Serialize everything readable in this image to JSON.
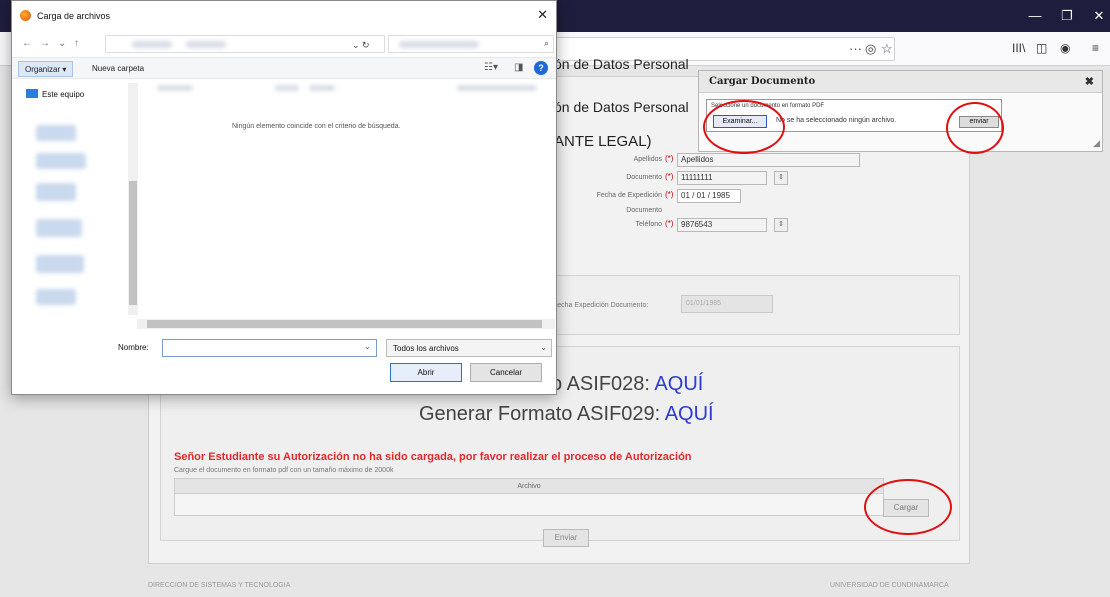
{
  "browser": {
    "window_controls": [
      "—",
      "❐",
      "✕"
    ],
    "url_actions": [
      "···",
      "◎",
      "☆"
    ],
    "toolbar_icons": [
      "III\\",
      "◫",
      "◉",
      "≡"
    ]
  },
  "page": {
    "heading_1": "ón de Datos Personal",
    "heading_2": "ón de Datos Personal",
    "heading_3": "ANTE LEGAL)",
    "form": {
      "apellidos_label": "Apellidos",
      "apellidos_value": "Apellidos",
      "documento_label": "Documento",
      "documento_value": "11111111",
      "fecha_label": "Fecha de Expedición",
      "fecha_label_2": "Documento",
      "fecha_value": "01 / 01 / 1985",
      "telefono_label": "Teléfono",
      "telefono_value": "9876543",
      "required_mark": "(*)"
    },
    "fecha_panel_label": "Fecha Expedición Documento:",
    "fecha_panel_value": "01/01/1985",
    "formats": {
      "line_1_prefix": "o ASIF028: ",
      "line_2_prefix": "Generar Formato ASIF029: ",
      "link_text": "AQUÍ"
    },
    "warning": "Señor Estudiante su Autorización no ha sido cargada, por favor realizar el proceso de Autorización",
    "upload_note": "Cargue el documento en formato pdf con un tamaño máximo de 2000k",
    "archivo_header": "Archivo",
    "cargar_button": "Cargar",
    "enviar_button": "Enviar",
    "footer_left": "DIRECCION DE SISTEMAS Y TECNOLOGIA",
    "footer_right": "UNIVERSIDAD DE CUNDINAMARCA"
  },
  "cargar_dialog": {
    "title": "Cargar Documento",
    "close": "✖",
    "instruction": "Seleccione un documento en formato PDF",
    "browse_button": "Examinar...",
    "no_file_text": "No se ha seleccionado ningún archivo.",
    "send_button": "enviar"
  },
  "file_dialog": {
    "title": "Carga de archivos",
    "close": "✕",
    "nav_back": "←",
    "nav_forward": "→",
    "nav_down": "⌄",
    "nav_up": "↑",
    "refresh": "⌄ ↻",
    "organize": "Organizar ▾",
    "new_folder": "Nueva carpeta",
    "help": "?",
    "nav_item": "Este equipo",
    "empty_message": "Ningún elemento coincide con el criterio de búsqueda.",
    "name_label": "Nombre:",
    "name_value": "",
    "filter": "Todos los archivos",
    "open_button": "Abrir",
    "cancel_button": "Cancelar"
  }
}
